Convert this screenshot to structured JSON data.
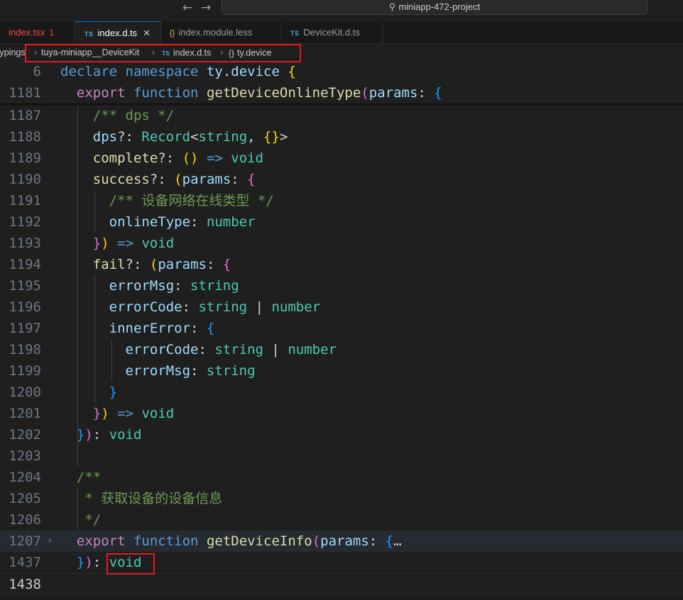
{
  "window": {
    "search_text": "miniapp-472-project"
  },
  "tabs": [
    {
      "label": "index.tsx",
      "badge": "1",
      "kind": "tsx"
    },
    {
      "label": "index.d.ts",
      "kind": "ts",
      "icon_text": "TS",
      "close": "✕"
    },
    {
      "label": "index.module.less",
      "kind": "less",
      "icon_text": "{}"
    },
    {
      "label": "DeviceKit.d.ts",
      "kind": "ts",
      "icon_text": "TS"
    }
  ],
  "breadcrumb": {
    "items": [
      "typings",
      "tuya-miniapp__DeviceKit",
      "index.d.ts",
      "ty.device"
    ],
    "ts_icon": "TS",
    "ns_icon": "{}",
    "sep": "›"
  },
  "lines": [
    {
      "num": "6",
      "segs": [
        [
          "kw",
          "declare"
        ],
        [
          "op",
          " "
        ],
        [
          "kw",
          "namespace"
        ],
        [
          "op",
          " "
        ],
        [
          "prop",
          "ty"
        ],
        [
          "op",
          "."
        ],
        [
          "prop",
          "device"
        ],
        [
          "op",
          " "
        ],
        [
          "p1",
          "{"
        ]
      ]
    },
    {
      "num": "1181",
      "segs": [
        [
          "op",
          "  "
        ],
        [
          "kw2",
          "export"
        ],
        [
          "op",
          " "
        ],
        [
          "kw",
          "function"
        ],
        [
          "op",
          " "
        ],
        [
          "fn",
          "getDeviceOnlineType"
        ],
        [
          "p2",
          "("
        ],
        [
          "prop",
          "params"
        ],
        [
          "op",
          ": "
        ],
        [
          "p3",
          "{"
        ]
      ]
    },
    {
      "num": "1187",
      "segs": [
        [
          "op",
          "    "
        ],
        [
          "cm",
          "/** dps */"
        ]
      ]
    },
    {
      "num": "1188",
      "segs": [
        [
          "op",
          "    "
        ],
        [
          "prop",
          "dps"
        ],
        [
          "op",
          "?: "
        ],
        [
          "ty",
          "Record"
        ],
        [
          "op",
          "<"
        ],
        [
          "ty",
          "string"
        ],
        [
          "op",
          ", "
        ],
        [
          "p1",
          "{}"
        ],
        [
          "op",
          ">"
        ]
      ]
    },
    {
      "num": "1189",
      "segs": [
        [
          "op",
          "    "
        ],
        [
          "fn",
          "complete"
        ],
        [
          "op",
          "?: "
        ],
        [
          "p1",
          "()"
        ],
        [
          "op",
          " "
        ],
        [
          "kw",
          "=>"
        ],
        [
          "op",
          " "
        ],
        [
          "ty",
          "void"
        ]
      ]
    },
    {
      "num": "1190",
      "segs": [
        [
          "op",
          "    "
        ],
        [
          "fn",
          "success"
        ],
        [
          "op",
          "?: "
        ],
        [
          "p1",
          "("
        ],
        [
          "prop",
          "params"
        ],
        [
          "op",
          ": "
        ],
        [
          "p2",
          "{"
        ]
      ]
    },
    {
      "num": "1191",
      "segs": [
        [
          "op",
          "      "
        ],
        [
          "cm",
          "/** 设备网络在线类型 */"
        ]
      ]
    },
    {
      "num": "1192",
      "segs": [
        [
          "op",
          "      "
        ],
        [
          "prop",
          "onlineType"
        ],
        [
          "op",
          ": "
        ],
        [
          "ty",
          "number"
        ]
      ]
    },
    {
      "num": "1193",
      "segs": [
        [
          "op",
          "    "
        ],
        [
          "p2",
          "}"
        ],
        [
          "p1",
          ")"
        ],
        [
          "op",
          " "
        ],
        [
          "kw",
          "=>"
        ],
        [
          "op",
          " "
        ],
        [
          "ty",
          "void"
        ]
      ]
    },
    {
      "num": "1194",
      "segs": [
        [
          "op",
          "    "
        ],
        [
          "fn",
          "fail"
        ],
        [
          "op",
          "?: "
        ],
        [
          "p1",
          "("
        ],
        [
          "prop",
          "params"
        ],
        [
          "op",
          ": "
        ],
        [
          "p2",
          "{"
        ]
      ]
    },
    {
      "num": "1195",
      "segs": [
        [
          "op",
          "      "
        ],
        [
          "prop",
          "errorMsg"
        ],
        [
          "op",
          ": "
        ],
        [
          "ty",
          "string"
        ]
      ]
    },
    {
      "num": "1196",
      "segs": [
        [
          "op",
          "      "
        ],
        [
          "prop",
          "errorCode"
        ],
        [
          "op",
          ": "
        ],
        [
          "ty",
          "string"
        ],
        [
          "op",
          " | "
        ],
        [
          "ty",
          "number"
        ]
      ]
    },
    {
      "num": "1197",
      "segs": [
        [
          "op",
          "      "
        ],
        [
          "prop",
          "innerError"
        ],
        [
          "op",
          ": "
        ],
        [
          "p3",
          "{"
        ]
      ]
    },
    {
      "num": "1198",
      "segs": [
        [
          "op",
          "        "
        ],
        [
          "prop",
          "errorCode"
        ],
        [
          "op",
          ": "
        ],
        [
          "ty",
          "string"
        ],
        [
          "op",
          " | "
        ],
        [
          "ty",
          "number"
        ]
      ]
    },
    {
      "num": "1199",
      "segs": [
        [
          "op",
          "        "
        ],
        [
          "prop",
          "errorMsg"
        ],
        [
          "op",
          ": "
        ],
        [
          "ty",
          "string"
        ]
      ]
    },
    {
      "num": "1200",
      "segs": [
        [
          "op",
          "      "
        ],
        [
          "p3",
          "}"
        ]
      ]
    },
    {
      "num": "1201",
      "segs": [
        [
          "op",
          "    "
        ],
        [
          "p2",
          "}"
        ],
        [
          "p1",
          ")"
        ],
        [
          "op",
          " "
        ],
        [
          "kw",
          "=>"
        ],
        [
          "op",
          " "
        ],
        [
          "ty",
          "void"
        ]
      ]
    },
    {
      "num": "1202",
      "segs": [
        [
          "op",
          "  "
        ],
        [
          "p3",
          "}"
        ],
        [
          "p2",
          ")"
        ],
        [
          "op",
          ": "
        ],
        [
          "ty",
          "void"
        ]
      ]
    },
    {
      "num": "1203",
      "segs": []
    },
    {
      "num": "1204",
      "segs": [
        [
          "op",
          "  "
        ],
        [
          "cm",
          "/**"
        ]
      ]
    },
    {
      "num": "1205",
      "segs": [
        [
          "op",
          "   "
        ],
        [
          "cm",
          "* 获取设备的设备信息"
        ]
      ]
    },
    {
      "num": "1206",
      "segs": [
        [
          "op",
          "   "
        ],
        [
          "cm",
          "*/"
        ]
      ]
    },
    {
      "num": "1207",
      "segs": [
        [
          "op",
          "  "
        ],
        [
          "kw2",
          "export"
        ],
        [
          "op",
          " "
        ],
        [
          "kw",
          "function"
        ],
        [
          "op",
          " "
        ],
        [
          "fn",
          "getDeviceInfo"
        ],
        [
          "p2",
          "("
        ],
        [
          "prop",
          "params"
        ],
        [
          "op",
          ": "
        ],
        [
          "p3",
          "{"
        ],
        [
          "ell",
          "…"
        ]
      ]
    },
    {
      "num": "1437",
      "segs": [
        [
          "op",
          "  "
        ],
        [
          "p3",
          "}"
        ],
        [
          "p2",
          ")"
        ],
        [
          "op",
          ": "
        ],
        [
          "ty",
          "void"
        ]
      ]
    },
    {
      "num": "1438",
      "segs": []
    }
  ],
  "fold_glyph": "›"
}
